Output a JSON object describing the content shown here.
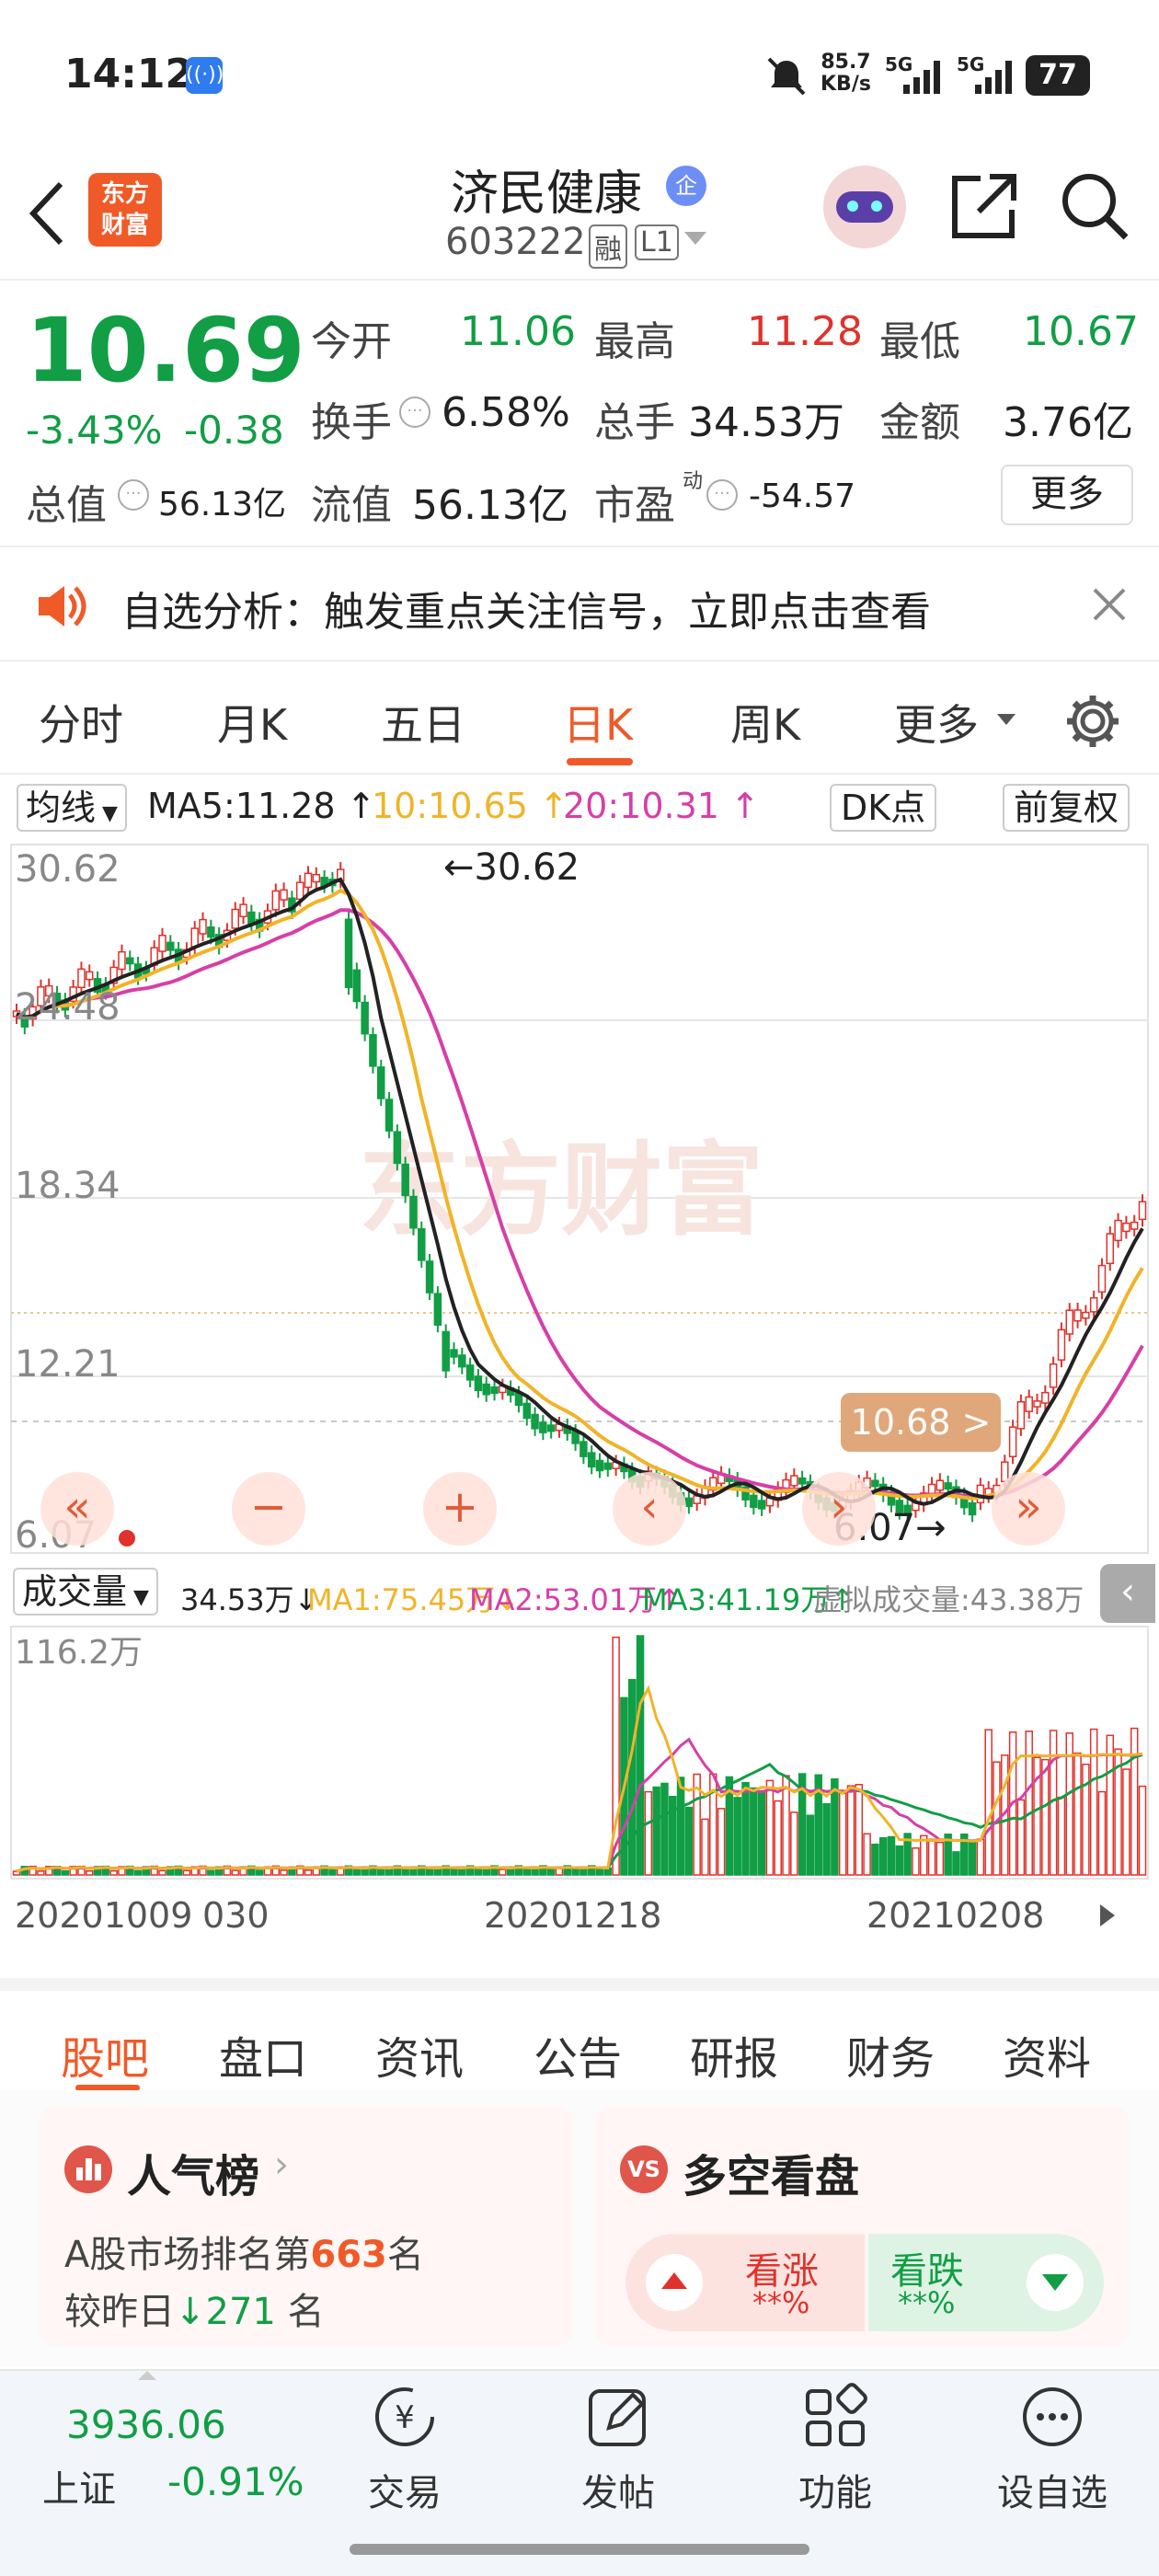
{
  "status_bar": {
    "time": "14:12",
    "net_speed": "85.7",
    "net_speed_unit": "KB/s",
    "net1": "5G",
    "net2": "5G",
    "battery": "77"
  },
  "header": {
    "brand_line1": "东方",
    "brand_line2": "财富",
    "title": "济民健康",
    "enterprise_badge": "企",
    "code": "603222",
    "tag_rong": "融",
    "tag_level": "L1"
  },
  "quote": {
    "price": "10.69",
    "change_pct": "-3.43%",
    "change": "-0.38",
    "open_label": "今开",
    "open": "11.06",
    "high_label": "最高",
    "high": "11.28",
    "low_label": "最低",
    "low": "10.67",
    "turnover_label": "换手",
    "turnover": "6.58%",
    "volume_label": "总手",
    "volume": "34.53万",
    "amount_label": "金额",
    "amount": "3.76亿",
    "mktcap_label": "总值",
    "mktcap": "56.13亿",
    "float_label": "流值",
    "float": "56.13亿",
    "pe_label": "市盈",
    "pe_sup": "动",
    "pe": "-54.57",
    "more_button": "更多"
  },
  "banner": {
    "text": "自选分析：触发重点关注信号，立即点击查看"
  },
  "tabs": [
    "分时",
    "月K",
    "五日",
    "日K",
    "周K",
    "更多"
  ],
  "active_tab": "日K",
  "ma_legend": {
    "selector": "均线",
    "ma5": "MA5:11.28",
    "ma10": "10:10.65",
    "ma20": "20:10.31",
    "dk_button": "DK点",
    "adjust_button": "前复权"
  },
  "price_axis": [
    "30.62",
    "24.48",
    "18.34",
    "12.21",
    "6.07"
  ],
  "annotations": {
    "high_marker": "30.62",
    "low_marker": "6.07",
    "current_price_tag": "10.68"
  },
  "watermark": "东方财富",
  "volume_legend": {
    "selector": "成交量",
    "vol": "34.53万",
    "ma1": "MA1:75.45万",
    "ma2": "MA2:53.01万",
    "ma3": "MA3:41.19万",
    "virtual": "虚拟成交量:43.38万"
  },
  "volume_axis_max": "116.2万",
  "date_axis": [
    "20201009",
    "030",
    "20201218",
    "20210208"
  ],
  "bottom_tabs": [
    "股吧",
    "盘口",
    "资讯",
    "公告",
    "研报",
    "财务",
    "资料"
  ],
  "active_bottom_tab": "股吧",
  "cards": {
    "popularity": {
      "title": "人气榜",
      "rank_prefix": "A股市场排名第",
      "rank": "663",
      "rank_suffix": "名",
      "change_prefix": "较昨日",
      "change": "271",
      "change_suffix": "名"
    },
    "bull_bear": {
      "title": "多空看盘",
      "up_label": "看涨",
      "up_value": "**%",
      "down_label": "看跌",
      "down_value": "**%"
    }
  },
  "dock": {
    "index_value": "3936.06",
    "index_name": "上证",
    "index_change": "-0.91%",
    "items": [
      "交易",
      "发帖",
      "功能",
      "设自选"
    ]
  },
  "colors": {
    "up": "#e0322c",
    "down": "#119e45",
    "accent": "#f0602a",
    "ma5": "#222222",
    "ma10": "#f0b429",
    "ma20": "#d63fa8"
  }
}
